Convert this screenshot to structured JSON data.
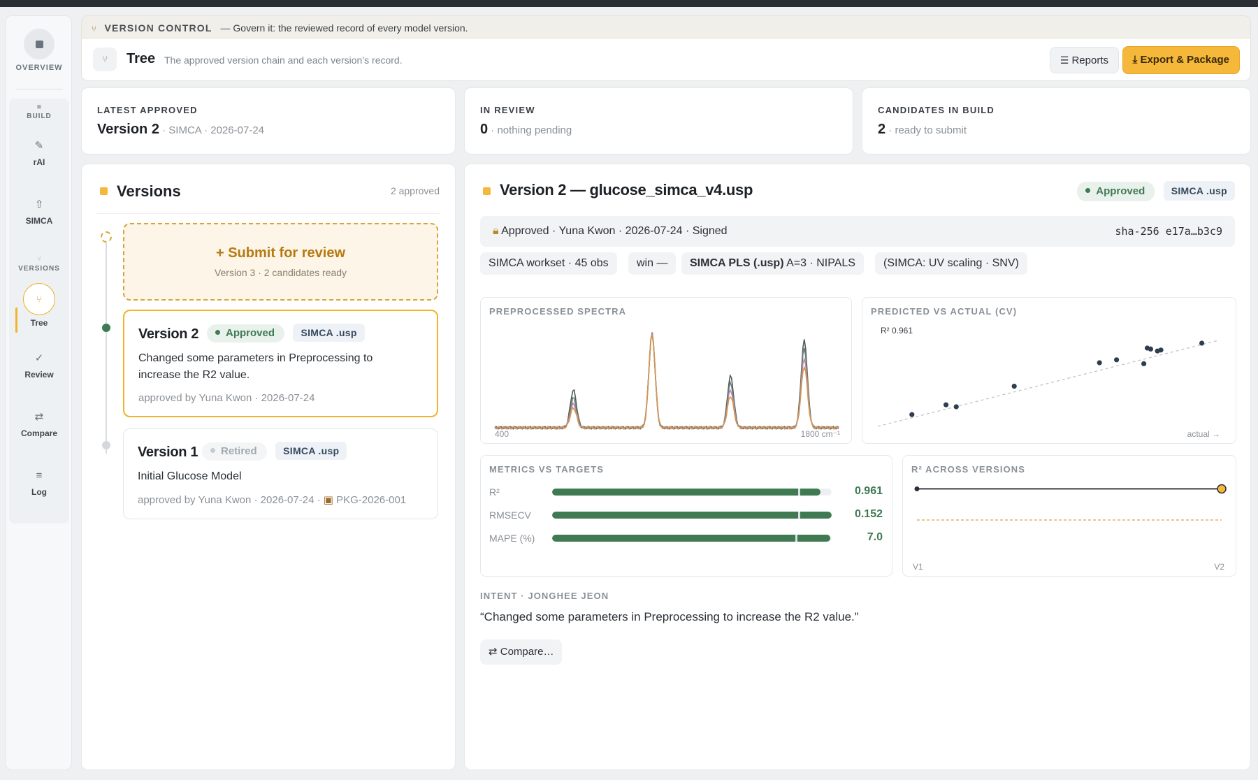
{
  "sidebar": {
    "overview_label": "OVERVIEW",
    "build_label": "BUILD",
    "rai_label": "rAI",
    "simca_label": "SIMCA",
    "versions_label": "VERSIONS",
    "tree_label": "Tree",
    "review_label": "Review",
    "compare_label": "Compare",
    "log_label": "Log",
    "icons": {
      "overview": "square-icon",
      "build": "square-icon",
      "rai": "pencil-icon",
      "simca": "upload-arrow-icon",
      "tree": "fork-icon",
      "review": "check-icon",
      "compare": "swap-arrows-icon",
      "log": "list-icon"
    }
  },
  "header": {
    "section_title": "VERSION CONTROL",
    "section_sub": "— Govern it: the reviewed record of every model version.",
    "title": "Tree",
    "subtitle": "The approved version chain and each version’s record.",
    "reports_label": "Reports",
    "export_label": "Export & Package",
    "accent": "#f5b83a"
  },
  "stats": [
    {
      "label": "LATEST APPROVED",
      "value": "Version 2",
      "detail": "· SIMCA · 2026-07-24"
    },
    {
      "label": "IN REVIEW",
      "value": "0",
      "detail": "· nothing pending"
    },
    {
      "label": "CANDIDATES IN BUILD",
      "value": "2",
      "detail": "· ready to submit"
    }
  ],
  "versions_panel": {
    "title": "Versions",
    "count": "2 approved",
    "submit_title": "+ Submit for review",
    "submit_sub": "Version 3 · 2 candidates ready",
    "items": [
      {
        "name": "Version 2",
        "status": "Approved",
        "format": "SIMCA .usp",
        "description": "Changed some parameters in Preprocessing to increase the R2 value.",
        "meta": "approved by Yuna Kwon · 2026-07-24"
      },
      {
        "name": "Version 1",
        "status": "Retired",
        "format": "SIMCA .usp",
        "description": "Initial Glucose Model",
        "meta": "approved by Yuna Kwon · 2026-07-24 ·",
        "package": "PKG-2026-001"
      }
    ]
  },
  "detail": {
    "title": "Version 2 — glucose_simca_v4.usp",
    "status": "Approved",
    "format": "SIMCA .usp",
    "signature": "Approved · Yuna Kwon · 2026-07-24 · Signed",
    "hash": "sha-256 e17a…b3c9",
    "chips": [
      "SIMCA workset · 45 obs",
      "win —",
      "A=3 · NIPALS",
      "(SIMCA: UV scaling · SNV)"
    ],
    "chip_bold": "SIMCA PLS (.usp)",
    "spectra_title": "PREPROCESSED SPECTRA",
    "spectra_x_min": "400",
    "spectra_x_max": "1800 cm⁻¹",
    "pred_title": "PREDICTED VS ACTUAL (CV)",
    "pred_r2": "R² 0.961",
    "pred_xlabel": "actual →",
    "metrics_title": "METRICS VS TARGETS",
    "metrics": [
      {
        "name": "R²",
        "value": "0.961",
        "fill": 0.96,
        "target": 0.88
      },
      {
        "name": "RMSECV",
        "value": "0.152",
        "fill": 1.0,
        "target": 0.88
      },
      {
        "name": "MAPE (%)",
        "value": "7.0",
        "fill": 0.995,
        "target": 0.87
      }
    ],
    "r2_title": "R² ACROSS VERSIONS",
    "r2_labels": [
      "V1",
      "V2"
    ],
    "intent_label": "INTENT · JONGHEE JEON",
    "intent_text": "“Changed some parameters in Preprocessing to increase the R2 value.”",
    "compare_label": "Compare…"
  },
  "colors": {
    "approved_green": "#3f7a52",
    "approved_bg": "#e9f1ec",
    "retired_gray": "#a3a9af",
    "accent": "#f5b83a"
  },
  "chart_data": [
    {
      "type": "line",
      "title": "PREPROCESSED SPECTRA",
      "xlim": [
        400,
        1800
      ],
      "x": [
        400,
        560,
        720,
        880,
        1040,
        1200,
        1360,
        1520,
        1660,
        1800
      ],
      "series": [
        {
          "values": [
            0.0,
            0.0,
            0.38,
            0.0,
            0.95,
            0.0,
            0.52,
            0.0,
            0.88,
            0.0
          ]
        },
        {
          "values": [
            0.0,
            0.0,
            0.3,
            0.0,
            0.95,
            0.0,
            0.45,
            0.0,
            0.8,
            0.0
          ]
        },
        {
          "values": [
            0.0,
            0.0,
            0.24,
            0.0,
            0.95,
            0.0,
            0.38,
            0.0,
            0.7,
            0.0
          ]
        },
        {
          "values": [
            0.0,
            0.0,
            0.2,
            0.0,
            0.95,
            0.0,
            0.32,
            0.0,
            0.62,
            0.0
          ]
        }
      ]
    },
    {
      "type": "scatter",
      "title": "PREDICTED VS ACTUAL (CV)",
      "xlabel": "actual →",
      "annotation": "R² 0.961",
      "xlim": [
        0,
        10
      ],
      "ylim": [
        0,
        10
      ],
      "points": [
        {
          "x": 1.0,
          "y": 1.2
        },
        {
          "x": 2.0,
          "y": 2.2
        },
        {
          "x": 2.3,
          "y": 2.0
        },
        {
          "x": 4.0,
          "y": 4.1
        },
        {
          "x": 6.5,
          "y": 6.5
        },
        {
          "x": 7.0,
          "y": 6.8
        },
        {
          "x": 7.8,
          "y": 6.4
        },
        {
          "x": 7.9,
          "y": 8.0
        },
        {
          "x": 8.0,
          "y": 7.9
        },
        {
          "x": 8.2,
          "y": 7.7
        },
        {
          "x": 8.3,
          "y": 7.8
        },
        {
          "x": 9.5,
          "y": 8.5
        }
      ]
    },
    {
      "type": "line",
      "title": "R² ACROSS VERSIONS",
      "categories": [
        "V1",
        "V2"
      ],
      "values": [
        0.961,
        0.961
      ],
      "target": 0.88,
      "ylim": [
        0.8,
        1.0
      ]
    }
  ]
}
